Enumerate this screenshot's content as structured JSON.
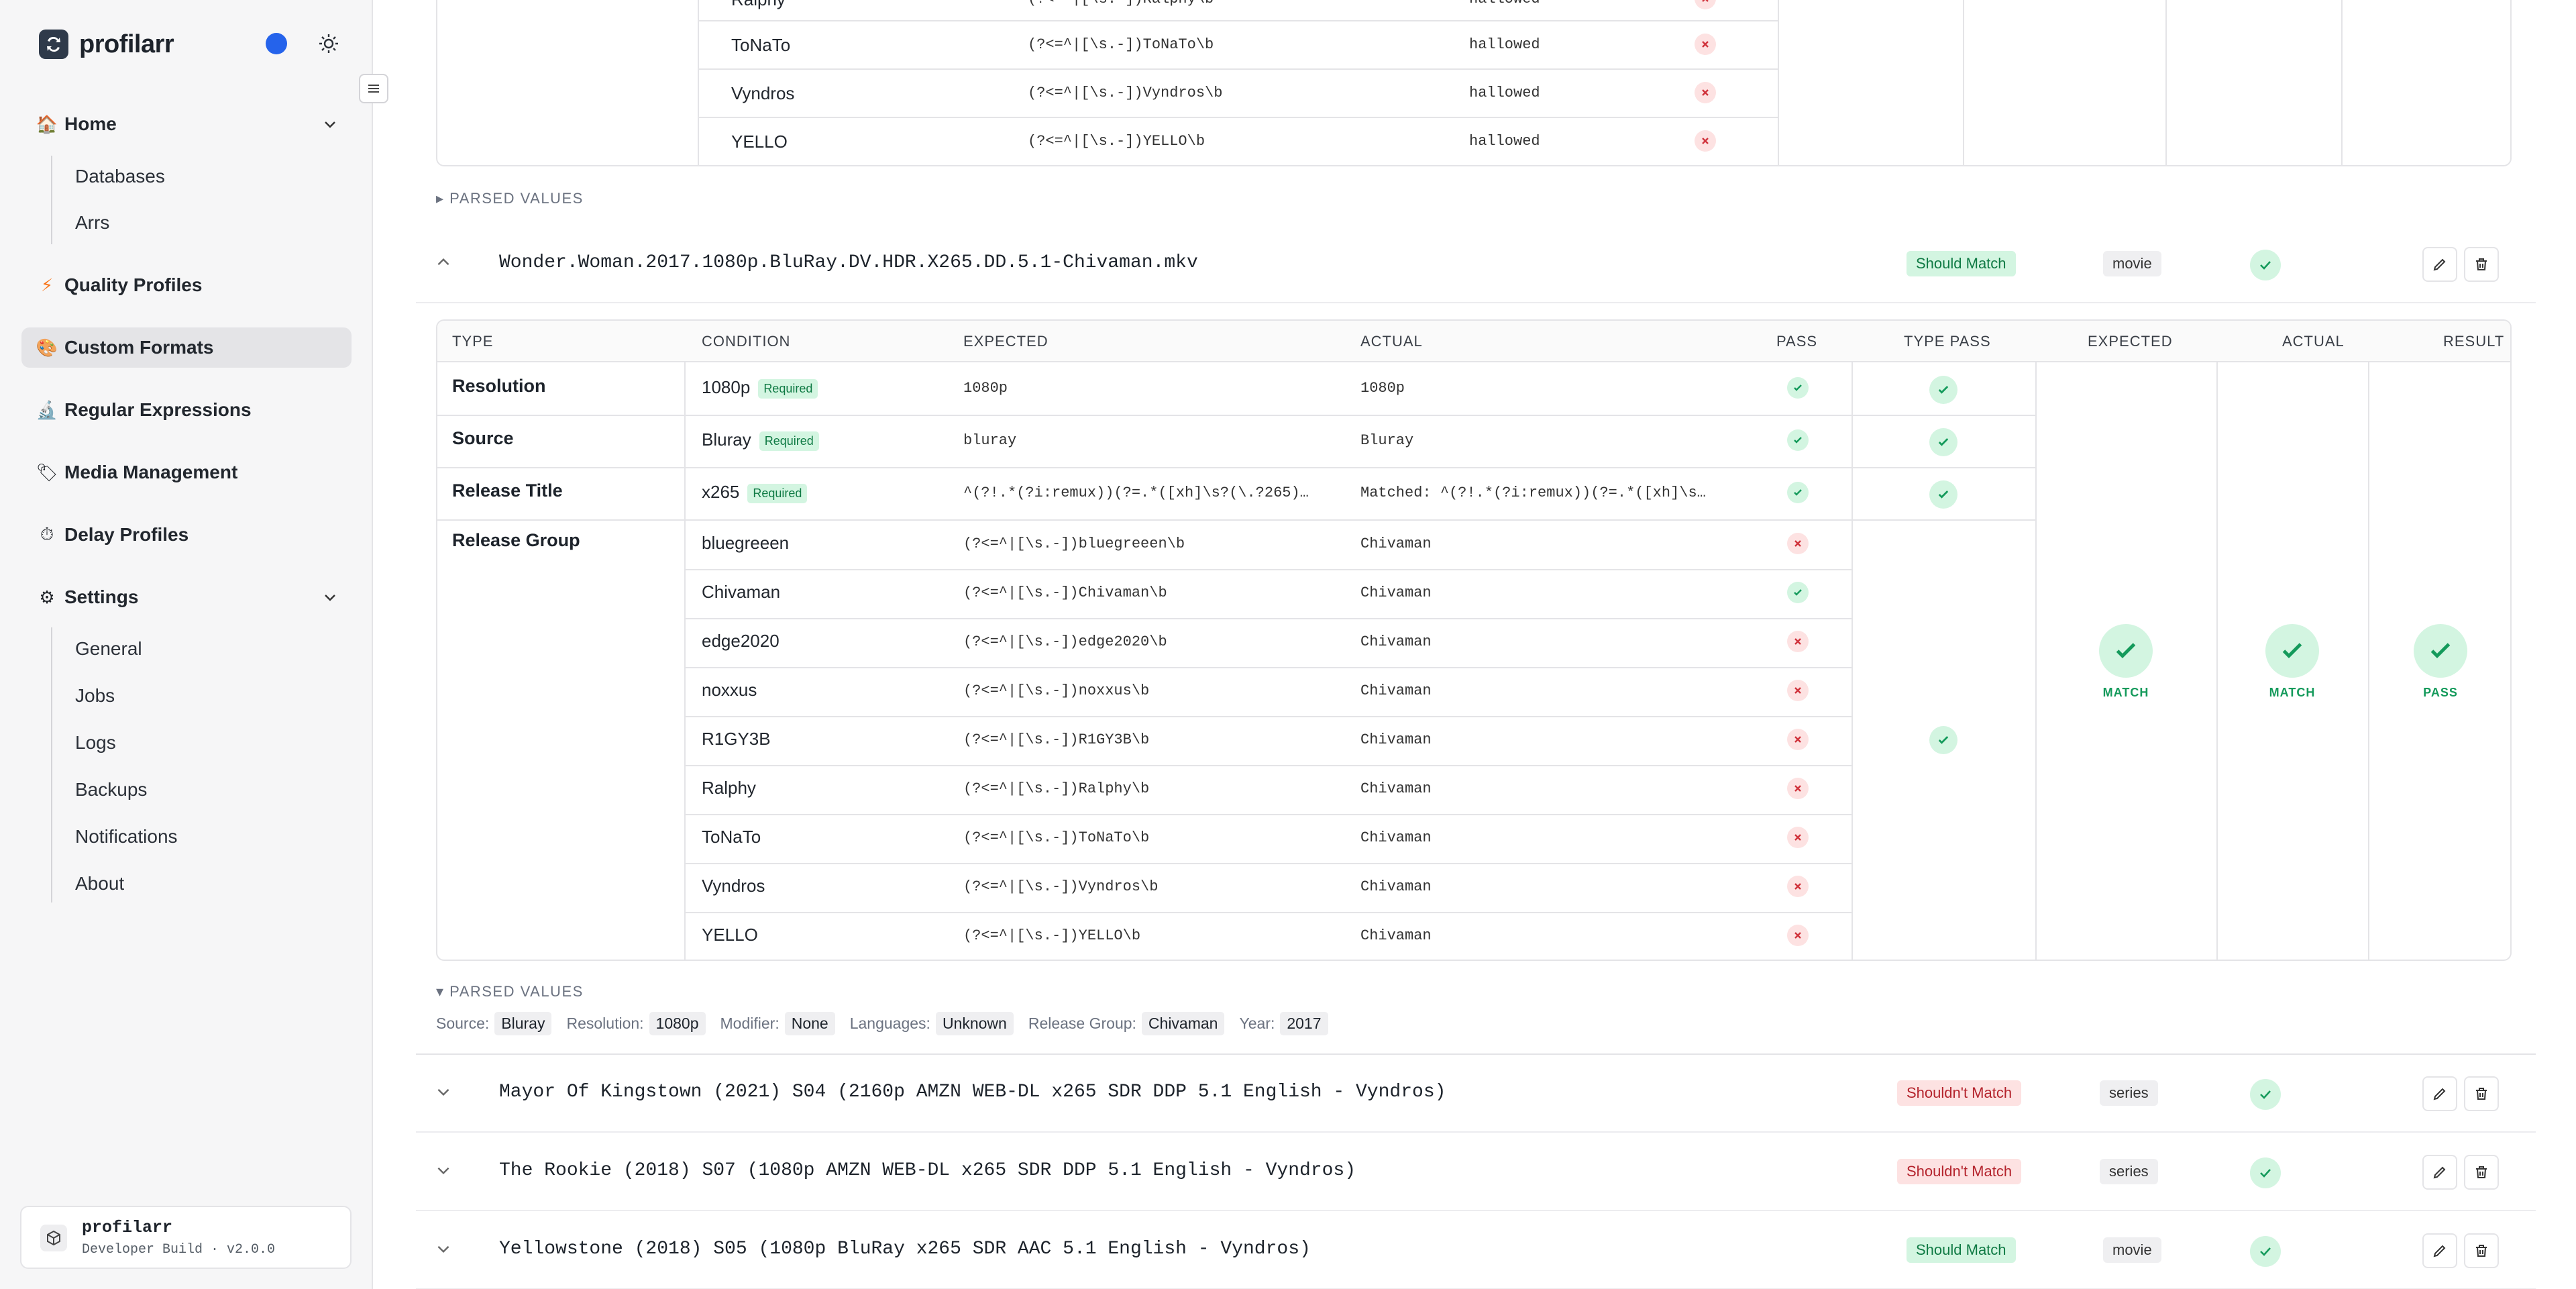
{
  "brand": {
    "name": "profilarr"
  },
  "nav": {
    "home": "Home",
    "home_sub": [
      "Databases",
      "Arrs"
    ],
    "quality_profiles": "Quality Profiles",
    "custom_formats": "Custom Formats",
    "regular_expressions": "Regular Expressions",
    "media_management": "Media Management",
    "delay_profiles": "Delay Profiles",
    "settings": "Settings",
    "settings_sub": [
      "General",
      "Jobs",
      "Logs",
      "Backups",
      "Notifications",
      "About"
    ]
  },
  "build": {
    "name": "profilarr",
    "version": "Developer Build · v2.0.0"
  },
  "top_table": {
    "partial_row": {
      "condition": "Ralphy",
      "expected": "(?<=^|[\\s.-])Ralphy\\b",
      "actual": "hallowed"
    },
    "rows": [
      {
        "condition": "ToNaTo",
        "expected": "(?<=^|[\\s.-])ToNaTo\\b",
        "actual": "hallowed"
      },
      {
        "condition": "Vyndros",
        "expected": "(?<=^|[\\s.-])Vyndros\\b",
        "actual": "hallowed"
      },
      {
        "condition": "YELLO",
        "expected": "(?<=^|[\\s.-])YELLO\\b",
        "actual": "hallowed"
      }
    ]
  },
  "parsed_values_collapsed": "▸ PARSED VALUES",
  "parsed_values_expanded": "▾ PARSED VALUES",
  "tests": [
    {
      "title": "Wonder.Woman.2017.1080p.BluRay.DV.HDR.X265.DD.5.1-Chivaman.mkv",
      "match": "Should Match",
      "type": "movie",
      "expanded": true
    },
    {
      "title": "Mayor Of Kingstown (2021) S04 (2160p AMZN WEB-DL x265 SDR DDP 5.1 English - Vyndros)",
      "match": "Shouldn't Match",
      "type": "series",
      "expanded": false
    },
    {
      "title": "The Rookie (2018) S07 (1080p AMZN WEB-DL x265 SDR DDP 5.1 English - Vyndros)",
      "match": "Shouldn't Match",
      "type": "series",
      "expanded": false
    },
    {
      "title": "Yellowstone (2018) S05 (1080p BluRay x265 SDR AAC 5.1 English - Vyndros)",
      "match": "Should Match",
      "type": "movie",
      "expanded": false
    }
  ],
  "detail": {
    "headers": [
      "TYPE",
      "CONDITION",
      "EXPECTED",
      "ACTUAL",
      "PASS",
      "TYPE PASS",
      "EXPECTED",
      "ACTUAL",
      "RESULT"
    ],
    "required_label": "Required",
    "groups": {
      "resolution": {
        "type": "Resolution",
        "condition": "1080p",
        "expected": "1080p",
        "actual": "1080p"
      },
      "source": {
        "type": "Source",
        "condition": "Bluray",
        "expected": "bluray",
        "actual": "Bluray"
      },
      "release_title": {
        "type": "Release Title",
        "condition": "x265",
        "expected": "^(?!.*(?i:remux))(?=.*([xh]\\s?(\\.?265)…",
        "actual": "Matched: ^(?!.*(?i:remux))(?=.*([xh]\\s…"
      },
      "release_group": {
        "type": "Release Group"
      }
    },
    "release_group_rows": [
      {
        "condition": "bluegreeen",
        "expected": "(?<=^|[\\s.-])bluegreeen\\b",
        "actual": "Chivaman",
        "pass": false
      },
      {
        "condition": "Chivaman",
        "expected": "(?<=^|[\\s.-])Chivaman\\b",
        "actual": "Chivaman",
        "pass": true
      },
      {
        "condition": "edge2020",
        "expected": "(?<=^|[\\s.-])edge2020\\b",
        "actual": "Chivaman",
        "pass": false
      },
      {
        "condition": "noxxus",
        "expected": "(?<=^|[\\s.-])noxxus\\b",
        "actual": "Chivaman",
        "pass": false
      },
      {
        "condition": "R1GY3B",
        "expected": "(?<=^|[\\s.-])R1GY3B\\b",
        "actual": "Chivaman",
        "pass": false
      },
      {
        "condition": "Ralphy",
        "expected": "(?<=^|[\\s.-])Ralphy\\b",
        "actual": "Chivaman",
        "pass": false
      },
      {
        "condition": "ToNaTo",
        "expected": "(?<=^|[\\s.-])ToNaTo\\b",
        "actual": "Chivaman",
        "pass": false
      },
      {
        "condition": "Vyndros",
        "expected": "(?<=^|[\\s.-])Vyndros\\b",
        "actual": "Chivaman",
        "pass": false
      },
      {
        "condition": "YELLO",
        "expected": "(?<=^|[\\s.-])YELLO\\b",
        "actual": "Chivaman",
        "pass": false
      }
    ],
    "summary": {
      "expected": "MATCH",
      "actual": "MATCH",
      "result": "PASS"
    }
  },
  "parsed": {
    "source_label": "Source:",
    "source": "Bluray",
    "resolution_label": "Resolution:",
    "resolution": "1080p",
    "modifier_label": "Modifier:",
    "modifier": "None",
    "languages_label": "Languages:",
    "languages": "Unknown",
    "release_group_label": "Release Group:",
    "release_group": "Chivaman",
    "year_label": "Year:",
    "year": "2017"
  },
  "colors": {
    "accent": "#2563eb",
    "success": "#149a5b",
    "danger": "#d0343d"
  }
}
